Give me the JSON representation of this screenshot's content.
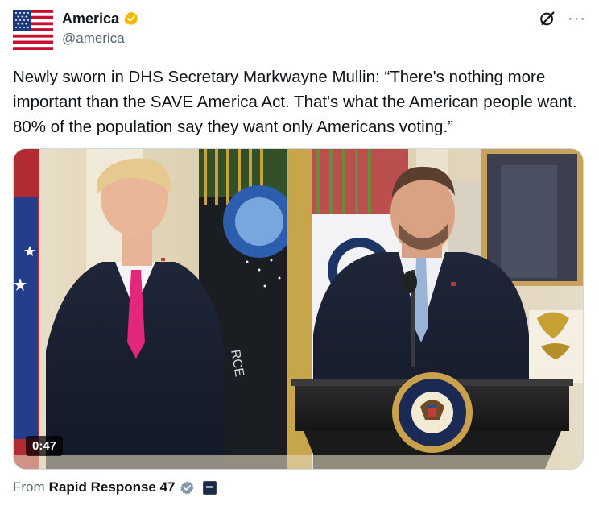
{
  "author": {
    "display_name": "America",
    "handle": "@america",
    "avatar": "us-flag-avatar",
    "verified_badge": "gold-verified-icon"
  },
  "header_icons": {
    "grok": "grok-icon",
    "more": "···"
  },
  "tweet": {
    "text": "Newly sworn in DHS Secretary Markwayne Mullin: “There's nothing more important than the SAVE America Act. That's what the American people want. 80% of the population say they want only Americans voting.”"
  },
  "media": {
    "type": "video",
    "duration": "0:47",
    "podium_seal_text": "SEAL OF THE PRESIDENT OF THE UNITED STATES"
  },
  "source": {
    "from_label": "From",
    "name": "Rapid Response 47",
    "verified_badge": "gray-verified-icon",
    "affiliate_badge": "affiliate-icon"
  },
  "colors": {
    "text": "#0f1419",
    "secondary_text": "#536471",
    "gold_badge": "#f5b800",
    "gray_badge": "#829aab"
  }
}
